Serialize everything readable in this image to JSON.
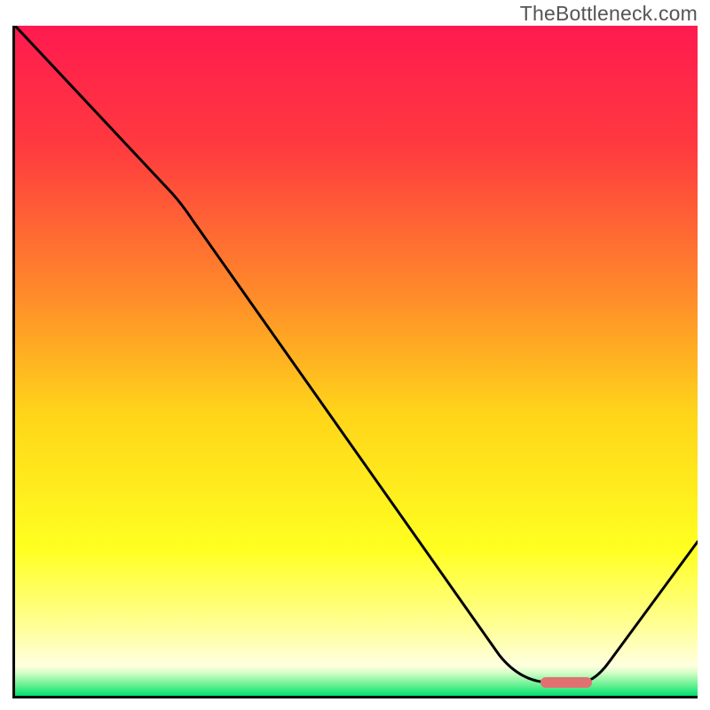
{
  "chart_data": {
    "type": "line",
    "watermark": "TheBottleneck.com",
    "xlim": [
      0,
      100
    ],
    "ylim": [
      0,
      100
    ],
    "gradient_stops": [
      {
        "pos": 0.0,
        "color": "#ff1a4f"
      },
      {
        "pos": 0.18,
        "color": "#ff3a3f"
      },
      {
        "pos": 0.4,
        "color": "#ff8a2a"
      },
      {
        "pos": 0.58,
        "color": "#ffd51a"
      },
      {
        "pos": 0.78,
        "color": "#ffff20"
      },
      {
        "pos": 0.9,
        "color": "#ffff9a"
      },
      {
        "pos": 0.955,
        "color": "#ffffe0"
      },
      {
        "pos": 0.965,
        "color": "#d8ffc8"
      },
      {
        "pos": 0.985,
        "color": "#60f090"
      },
      {
        "pos": 1.0,
        "color": "#00e070"
      }
    ],
    "series": [
      {
        "name": "bottleneck-curve",
        "x": [
          0,
          23,
          73,
          78,
          83,
          100
        ],
        "y": [
          100,
          75,
          3,
          2,
          2,
          23
        ]
      }
    ],
    "marker": {
      "x_start": 77,
      "x_end": 84.5,
      "y": 2.0
    },
    "colors": {
      "line": "#000000",
      "marker": "#e17171"
    }
  }
}
